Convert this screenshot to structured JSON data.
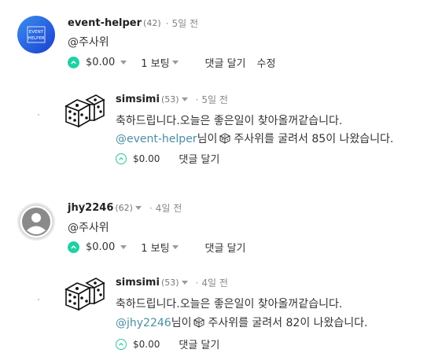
{
  "comments": [
    {
      "author": "event-helper",
      "rep": "(42)",
      "time": "5일 전",
      "avatar_text": [
        "EVENT",
        "HELPER"
      ],
      "body": "@주사위",
      "amount": "$0.00",
      "votes": "1 보팅",
      "actions": [
        "댓글 달기",
        "수정"
      ]
    },
    {
      "author": "simsimi",
      "rep": "(53)",
      "time": "5일 전",
      "line1": "축하드립니다.오늘은 좋은일이 찾아올꺼같습니다.",
      "mention": "@event-helper",
      "line2_mid": "님이",
      "line2_end": "주사위를 굴려서 85이 나왔습니다.",
      "amount": "$0.00",
      "reply": "댓글 달기"
    },
    {
      "author": "jhy2246",
      "rep": "(62)",
      "time": "4일 전",
      "body": "@주사위",
      "amount": "$0.00",
      "votes": "1 보팅",
      "reply": "댓글 달기"
    },
    {
      "author": "simsimi",
      "rep": "(53)",
      "time": "4일 전",
      "line1": "축하드립니다.오늘은 좋은일이 찾아올꺼같습니다.",
      "mention": "@jhy2246",
      "line2_mid": "님이",
      "line2_end": "주사위를 굴려서 82이 나왔습니다.",
      "amount": "$0.00",
      "reply": "댓글 달기"
    }
  ],
  "colors": {
    "upvote": "#1fd1a4",
    "mention": "#4a8fa3",
    "avatar_blue": "#1e5bd6"
  },
  "icons": [
    "upvote-icon",
    "dice-icon",
    "user-avatar-icon",
    "caret-down-icon"
  ]
}
